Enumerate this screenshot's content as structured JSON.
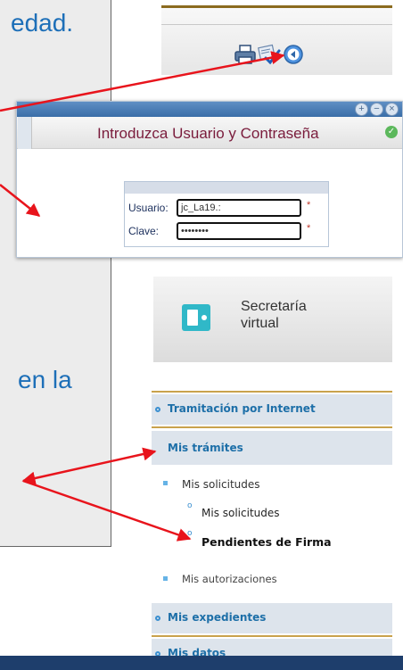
{
  "slide": {
    "text_top": "edad.",
    "text_bottom": "en la"
  },
  "toolbar": {
    "icons": [
      "print-icon",
      "sign-check-icon",
      "back-icon"
    ]
  },
  "login": {
    "title": "Introduzca Usuario y Contraseña",
    "window_buttons": [
      "+",
      "−",
      "×"
    ],
    "usuario_label": "Usuario:",
    "usuario_value": "jc_La19.:",
    "clave_label": "Clave:",
    "clave_value": "••••••••",
    "required_mark": "*"
  },
  "secretaria": {
    "title_line1": "Secretaría",
    "title_line2": "virtual"
  },
  "menu": {
    "tramitacion": "Tramitación por Internet",
    "mis_tramites": "Mis trámites",
    "mis_solicitudes": "Mis solicitudes",
    "mis_solicitudes_sub": "Mis solicitudes",
    "pendientes_firma": "Pendientes de Firma",
    "mis_autorizaciones": "Mis autorizaciones",
    "mis_expedientes": "Mis expedientes",
    "mis_datos": "Mis datos"
  },
  "colors": {
    "arrow": "#e8141c",
    "accent_text": "#1d6fb8",
    "menu_link": "#1d6fa8",
    "login_title": "#7a1c3c"
  }
}
